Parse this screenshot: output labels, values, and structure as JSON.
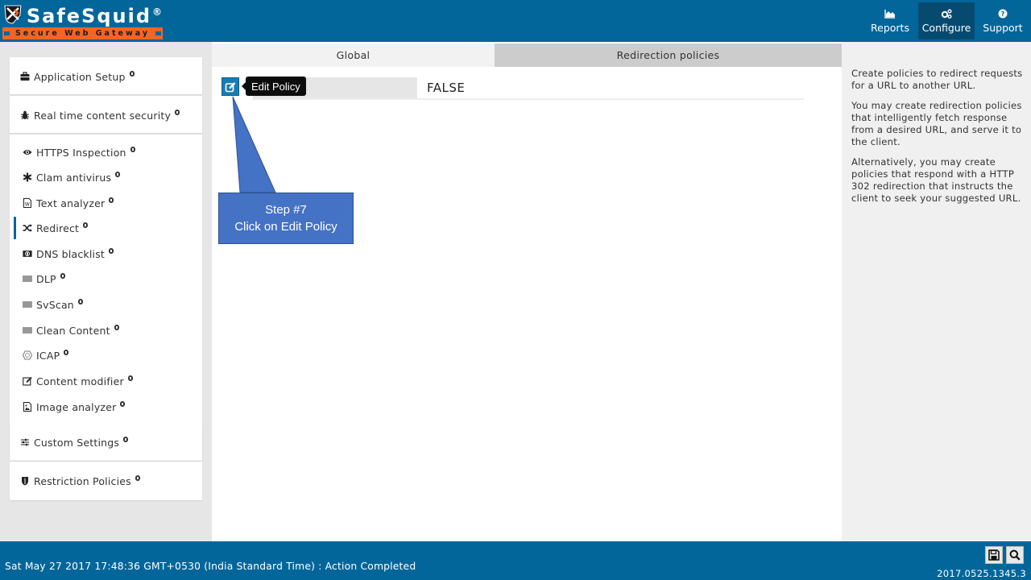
{
  "header": {
    "logo_text": "SafeSquid",
    "logo_reg": "®",
    "logo_tagline": "Secure Web Gateway",
    "nav": [
      {
        "label": "Reports",
        "icon": "area-chart-icon",
        "active": false
      },
      {
        "label": "Configure",
        "icon": "cogs-icon",
        "active": true
      },
      {
        "label": "Support",
        "icon": "question-circle-icon",
        "active": false
      }
    ]
  },
  "sidebar": {
    "application_setup": {
      "label": "Application Setup",
      "icon": "briefcase-icon"
    },
    "real_time_content_security": {
      "label": "Real time content security",
      "icon": "bug-icon"
    },
    "items": [
      {
        "label": "HTTPS Inspection",
        "icon": "eye-icon"
      },
      {
        "label": "Clam antivirus",
        "icon": "asterisk-icon"
      },
      {
        "label": "Text analyzer",
        "icon": "word-file-icon"
      },
      {
        "label": "Redirect",
        "icon": "random-icon",
        "active": true
      },
      {
        "label": "DNS blacklist",
        "icon": "dns-icon"
      },
      {
        "label": "DLP",
        "icon": "barcode-icon"
      },
      {
        "label": "SvScan",
        "icon": "barcode-icon"
      },
      {
        "label": "Clean Content",
        "icon": "barcode-icon"
      },
      {
        "label": "ICAP",
        "icon": "hexagon-icon"
      },
      {
        "label": "Content modifier",
        "icon": "edit-icon"
      },
      {
        "label": "Image analyzer",
        "icon": "image-file-icon"
      }
    ],
    "custom_settings": {
      "label": "Custom Settings",
      "icon": "sliders-icon"
    },
    "restriction_policies": {
      "label": "Restriction Policies",
      "icon": "shield-icon"
    }
  },
  "main": {
    "tabs": [
      {
        "label": "Global",
        "active": false
      },
      {
        "label": "Redirection policies",
        "active": true
      }
    ],
    "row": {
      "value": "FALSE",
      "edit_tooltip": "Edit Policy"
    }
  },
  "callout": {
    "line1": "Step #7",
    "line2": "Click on Edit Policy"
  },
  "right_panel": {
    "paragraphs": [
      "Create policies to redirect requests for a URL to another URL.",
      "You may create redirection policies that intelligently fetch response from a desired URL, and serve it to the client.",
      "Alternatively, you may create policies that respond with a HTTP 302 redirection that instructs the client to seek your suggested URL."
    ]
  },
  "footer": {
    "status": "Sat May 27 2017 17:48:36 GMT+0530 (India Standard Time) : Action Completed",
    "version": "2017.0525.1345.3",
    "buttons": [
      {
        "name": "save",
        "icon": "floppy-disk-icon"
      },
      {
        "name": "search",
        "icon": "search-icon"
      }
    ]
  },
  "colors": {
    "brand_blue": "#02669a",
    "nav_active": "#064a70",
    "logo_orange": "#f26522",
    "callout_blue": "#4472c4",
    "edit_button": "#1b7bb4"
  }
}
